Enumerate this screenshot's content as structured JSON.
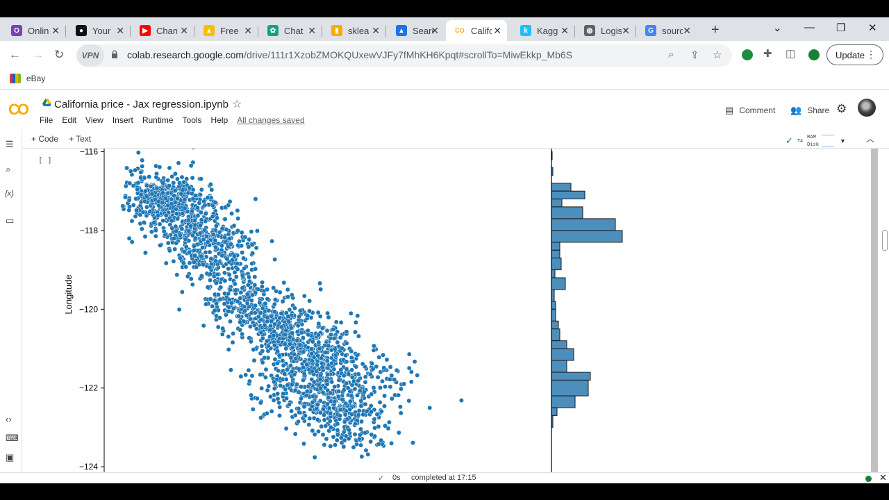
{
  "browser": {
    "tabs": [
      {
        "label": "Onlin",
        "icon": "tor-icon",
        "color": "#7b3fbf",
        "glyph": "O"
      },
      {
        "label": "Your",
        "icon": "medium-icon",
        "color": "#111111",
        "glyph": "●"
      },
      {
        "label": "Chan",
        "icon": "youtube-icon",
        "color": "#ff0000",
        "glyph": "▶"
      },
      {
        "label": "Free",
        "icon": "google-ads-icon",
        "color": "#fbbc04",
        "glyph": "▲"
      },
      {
        "label": "Chat",
        "icon": "chatgpt-icon",
        "color": "#10a37f",
        "glyph": "✿"
      },
      {
        "label": "sklea",
        "icon": "bar-chart-icon",
        "color": "#f9ab00",
        "glyph": "▮"
      },
      {
        "label": "Searc",
        "icon": "google-drive-icon",
        "color": "#1a73e8",
        "glyph": "▲"
      },
      {
        "label": "Califo",
        "icon": "colab-icon",
        "color": "#f9ab00",
        "glyph": "CO",
        "active": true
      },
      {
        "label": "Kagg",
        "icon": "kaggle-icon",
        "color": "#20beff",
        "glyph": "k"
      },
      {
        "label": "Logis",
        "icon": "globe-icon",
        "color": "#5f6368",
        "glyph": "◍"
      },
      {
        "label": "sourc",
        "icon": "google-icon",
        "color": "#4285f4",
        "glyph": "G"
      }
    ],
    "new_tab": "+",
    "url_host": "colab.research.google.com",
    "url_rest": "/drive/111r1XzobZMOKQUxewVJFy7fMhKH6Kpqt#scrollTo=MiwEkkp_Mb6S",
    "vpn_label": "VPN",
    "update_label": "Update",
    "bookmarks": [
      {
        "label": "eBay"
      }
    ]
  },
  "colab": {
    "title": "California price - Jax regression.ipynb",
    "menu": [
      "File",
      "Edit",
      "View",
      "Insert",
      "Runtime",
      "Tools",
      "Help"
    ],
    "saved_status": "All changes saved",
    "comment_label": "Comment",
    "share_label": "Share",
    "add_code": "+ Code",
    "add_text": "+ Text",
    "runtime_label": "T4",
    "ram_label": "RAM",
    "disk_label": "Disk",
    "cell_bracket": "[ ]"
  },
  "status": {
    "duration": "0s",
    "message": "completed at 17:15"
  },
  "colors": {
    "point": "#1f77b4",
    "bar": "#4c8fbd",
    "accent": "#188038"
  },
  "chart_data": {
    "type": "scatter",
    "subtype": "jointplot (scatter + marginal histogram)",
    "xlabel": "",
    "ylabel": "Longitude",
    "yticks": [
      -116,
      -118,
      -120,
      -122,
      -124
    ],
    "ylim": [
      -124.2,
      -115.9
    ],
    "x_axis_visible": false,
    "point_clusters": [
      {
        "x_start": 0.04,
        "y_start": -116.7,
        "x_end": 0.56,
        "y_end": -123.3,
        "spread": 0.45,
        "count": 900
      },
      {
        "x_start": 0.06,
        "y_start": -116.9,
        "x_end": 0.14,
        "y_end": -117.5,
        "spread": 0.25,
        "count": 220
      },
      {
        "x_start": 0.12,
        "y_start": -117.1,
        "x_end": 0.24,
        "y_end": -119.0,
        "spread": 0.25,
        "count": 260
      },
      {
        "x_start": 0.25,
        "y_start": -119.6,
        "x_end": 0.48,
        "y_end": -121.8,
        "spread": 0.3,
        "count": 320
      },
      {
        "x_start": 0.4,
        "y_start": -120.3,
        "x_end": 0.6,
        "y_end": -122.2,
        "spread": 0.35,
        "count": 240
      },
      {
        "x_start": 0.34,
        "y_start": -122.0,
        "x_end": 0.52,
        "y_end": -122.9,
        "spread": 0.3,
        "count": 200
      }
    ],
    "marginal_histogram": {
      "orientation": "horizontal",
      "bins": [
        {
          "lo": -116.2,
          "hi": -116.0,
          "count": 1
        },
        {
          "lo": -116.6,
          "hi": -116.4,
          "count": 2
        },
        {
          "lo": -117.0,
          "hi": -116.8,
          "count": 28
        },
        {
          "lo": -117.2,
          "hi": -117.0,
          "count": 48
        },
        {
          "lo": -117.4,
          "hi": -117.2,
          "count": 15
        },
        {
          "lo": -117.7,
          "hi": -117.4,
          "count": 45
        },
        {
          "lo": -118.0,
          "hi": -117.7,
          "count": 92
        },
        {
          "lo": -118.3,
          "hi": -118.0,
          "count": 102
        },
        {
          "lo": -118.5,
          "hi": -118.3,
          "count": 12
        },
        {
          "lo": -118.7,
          "hi": -118.5,
          "count": 12
        },
        {
          "lo": -119.0,
          "hi": -118.7,
          "count": 14
        },
        {
          "lo": -119.2,
          "hi": -119.0,
          "count": 5
        },
        {
          "lo": -119.5,
          "hi": -119.2,
          "count": 20
        },
        {
          "lo": -119.8,
          "hi": -119.5,
          "count": 4
        },
        {
          "lo": -120.0,
          "hi": -119.8,
          "count": 6
        },
        {
          "lo": -120.3,
          "hi": -120.0,
          "count": 6
        },
        {
          "lo": -120.5,
          "hi": -120.3,
          "count": 10
        },
        {
          "lo": -120.8,
          "hi": -120.5,
          "count": 12
        },
        {
          "lo": -121.0,
          "hi": -120.8,
          "count": 22
        },
        {
          "lo": -121.3,
          "hi": -121.0,
          "count": 32
        },
        {
          "lo": -121.6,
          "hi": -121.3,
          "count": 22
        },
        {
          "lo": -121.8,
          "hi": -121.6,
          "count": 56
        },
        {
          "lo": -122.2,
          "hi": -121.8,
          "count": 53
        },
        {
          "lo": -122.5,
          "hi": -122.2,
          "count": 34
        },
        {
          "lo": -122.7,
          "hi": -122.5,
          "count": 8
        },
        {
          "lo": -123.0,
          "hi": -122.7,
          "count": 2
        }
      ]
    }
  }
}
